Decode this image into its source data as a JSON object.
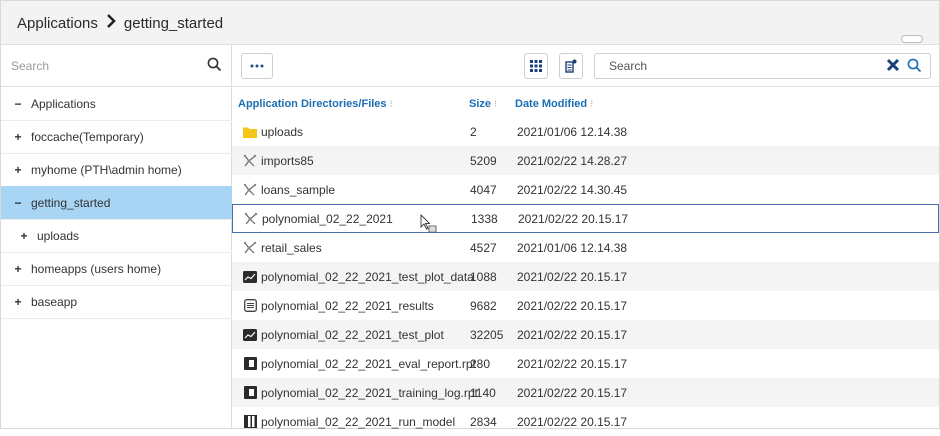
{
  "header": {
    "breadcrumb_root": "Applications",
    "breadcrumb_current": "getting_started"
  },
  "left_panel": {
    "search_placeholder": "Search",
    "tree": [
      {
        "label": "Applications",
        "sign": "−",
        "selected": false,
        "child": false
      },
      {
        "label": "foccache(Temporary)",
        "sign": "+",
        "selected": false,
        "child": false
      },
      {
        "label": "myhome (PTH\\admin home)",
        "sign": "+",
        "selected": false,
        "child": false
      },
      {
        "label": "getting_started",
        "sign": "−",
        "selected": true,
        "child": false
      },
      {
        "label": "uploads",
        "sign": "+",
        "selected": false,
        "child": true
      },
      {
        "label": "homeapps (users home)",
        "sign": "+",
        "selected": false,
        "child": false
      },
      {
        "label": "baseapp",
        "sign": "+",
        "selected": false,
        "child": false
      }
    ]
  },
  "toolbar": {
    "search_placeholder": "Search"
  },
  "table": {
    "columns": [
      "Application Directories/Files",
      "Size",
      "Date Modified"
    ],
    "rows": [
      {
        "icon": "folder-icon",
        "name": "uploads",
        "size": "2",
        "date": "2021/01/06 12.14.38"
      },
      {
        "icon": "model-icon",
        "name": "imports85",
        "size": "5209",
        "date": "2021/02/22 14.28.27"
      },
      {
        "icon": "model-icon",
        "name": "loans_sample",
        "size": "4047",
        "date": "2021/02/22 14.30.45"
      },
      {
        "icon": "model-icon",
        "name": "polynomial_02_22_2021",
        "size": "1338",
        "date": "2021/02/22 20.15.17"
      },
      {
        "icon": "model-icon",
        "name": "retail_sales",
        "size": "4527",
        "date": "2021/01/06 12.14.38"
      },
      {
        "icon": "plot-data-icon",
        "name": "polynomial_02_22_2021_test_plot_data",
        "size": "1088",
        "date": "2021/02/22 20.15.17"
      },
      {
        "icon": "results-icon",
        "name": "polynomial_02_22_2021_results",
        "size": "9682",
        "date": "2021/02/22 20.15.17"
      },
      {
        "icon": "plot-icon",
        "name": "polynomial_02_22_2021_test_plot",
        "size": "32205",
        "date": "2021/02/22 20.15.17"
      },
      {
        "icon": "report-icon",
        "name": "polynomial_02_22_2021_eval_report.rpt",
        "size": "280",
        "date": "2021/02/22 20.15.17"
      },
      {
        "icon": "report-icon",
        "name": "polynomial_02_22_2021_training_log.rpt",
        "size": "1140",
        "date": "2021/02/22 20.15.17"
      },
      {
        "icon": "run-model-icon",
        "name": "polynomial_02_22_2021_run_model",
        "size": "2834",
        "date": "2021/02/22 20.15.17"
      }
    ]
  },
  "colors": {
    "accent": "#1b6fb5",
    "selected_bg": "#a7d5f3",
    "folder": "#f5c518"
  }
}
